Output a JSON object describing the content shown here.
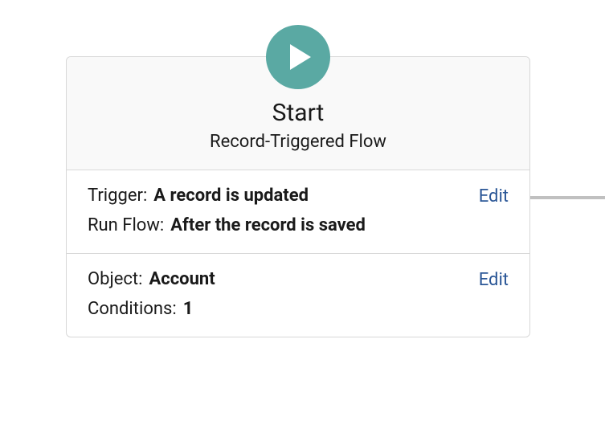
{
  "header": {
    "title": "Start",
    "subtitle": "Record-Triggered Flow"
  },
  "sections": [
    {
      "rows": [
        {
          "label": "Trigger:",
          "value": "A record is updated"
        },
        {
          "label": "Run Flow:",
          "value": "After the record is saved"
        }
      ],
      "edit_label": "Edit"
    },
    {
      "rows": [
        {
          "label": "Object:",
          "value": "Account"
        },
        {
          "label": "Conditions:",
          "value": "1"
        }
      ],
      "edit_label": "Edit"
    }
  ]
}
